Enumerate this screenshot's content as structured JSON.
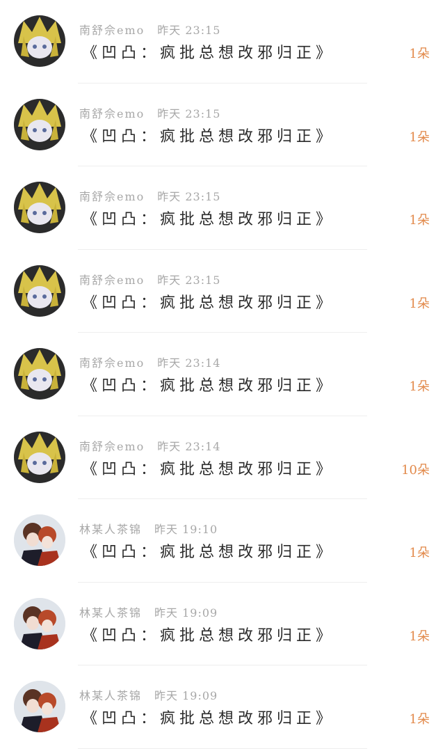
{
  "items": [
    {
      "user": "南舒佘emo",
      "time": "昨天 23:15",
      "title": "《凹凸：疯批总想改邪归正》",
      "count": "1朵",
      "avatar": "yellow-hair-icon"
    },
    {
      "user": "南舒佘emo",
      "time": "昨天 23:15",
      "title": "《凹凸：疯批总想改邪归正》",
      "count": "1朵",
      "avatar": "yellow-hair-icon"
    },
    {
      "user": "南舒佘emo",
      "time": "昨天 23:15",
      "title": "《凹凸：疯批总想改邪归正》",
      "count": "1朵",
      "avatar": "yellow-hair-icon"
    },
    {
      "user": "南舒佘emo",
      "time": "昨天 23:15",
      "title": "《凹凸：疯批总想改邪归正》",
      "count": "1朵",
      "avatar": "yellow-hair-icon"
    },
    {
      "user": "南舒佘emo",
      "time": "昨天 23:14",
      "title": "《凹凸：疯批总想改邪归正》",
      "count": "1朵",
      "avatar": "yellow-hair-icon"
    },
    {
      "user": "南舒佘emo",
      "time": "昨天 23:14",
      "title": "《凹凸：疯批总想改邪归正》",
      "count": "10朵",
      "avatar": "yellow-hair-icon"
    },
    {
      "user": "林某人茶锦",
      "time": "昨天 19:10",
      "title": "《凹凸：疯批总想改邪归正》",
      "count": "1朵",
      "avatar": "couple-icon"
    },
    {
      "user": "林某人茶锦",
      "time": "昨天 19:09",
      "title": "《凹凸：疯批总想改邪归正》",
      "count": "1朵",
      "avatar": "couple-icon"
    },
    {
      "user": "林某人茶锦",
      "time": "昨天 19:09",
      "title": "《凹凸：疯批总想改邪归正》",
      "count": "1朵",
      "avatar": "couple-icon"
    }
  ],
  "colors": {
    "count": "#e2894a",
    "meta": "#a7a7a7",
    "title": "#2a2a2a"
  }
}
